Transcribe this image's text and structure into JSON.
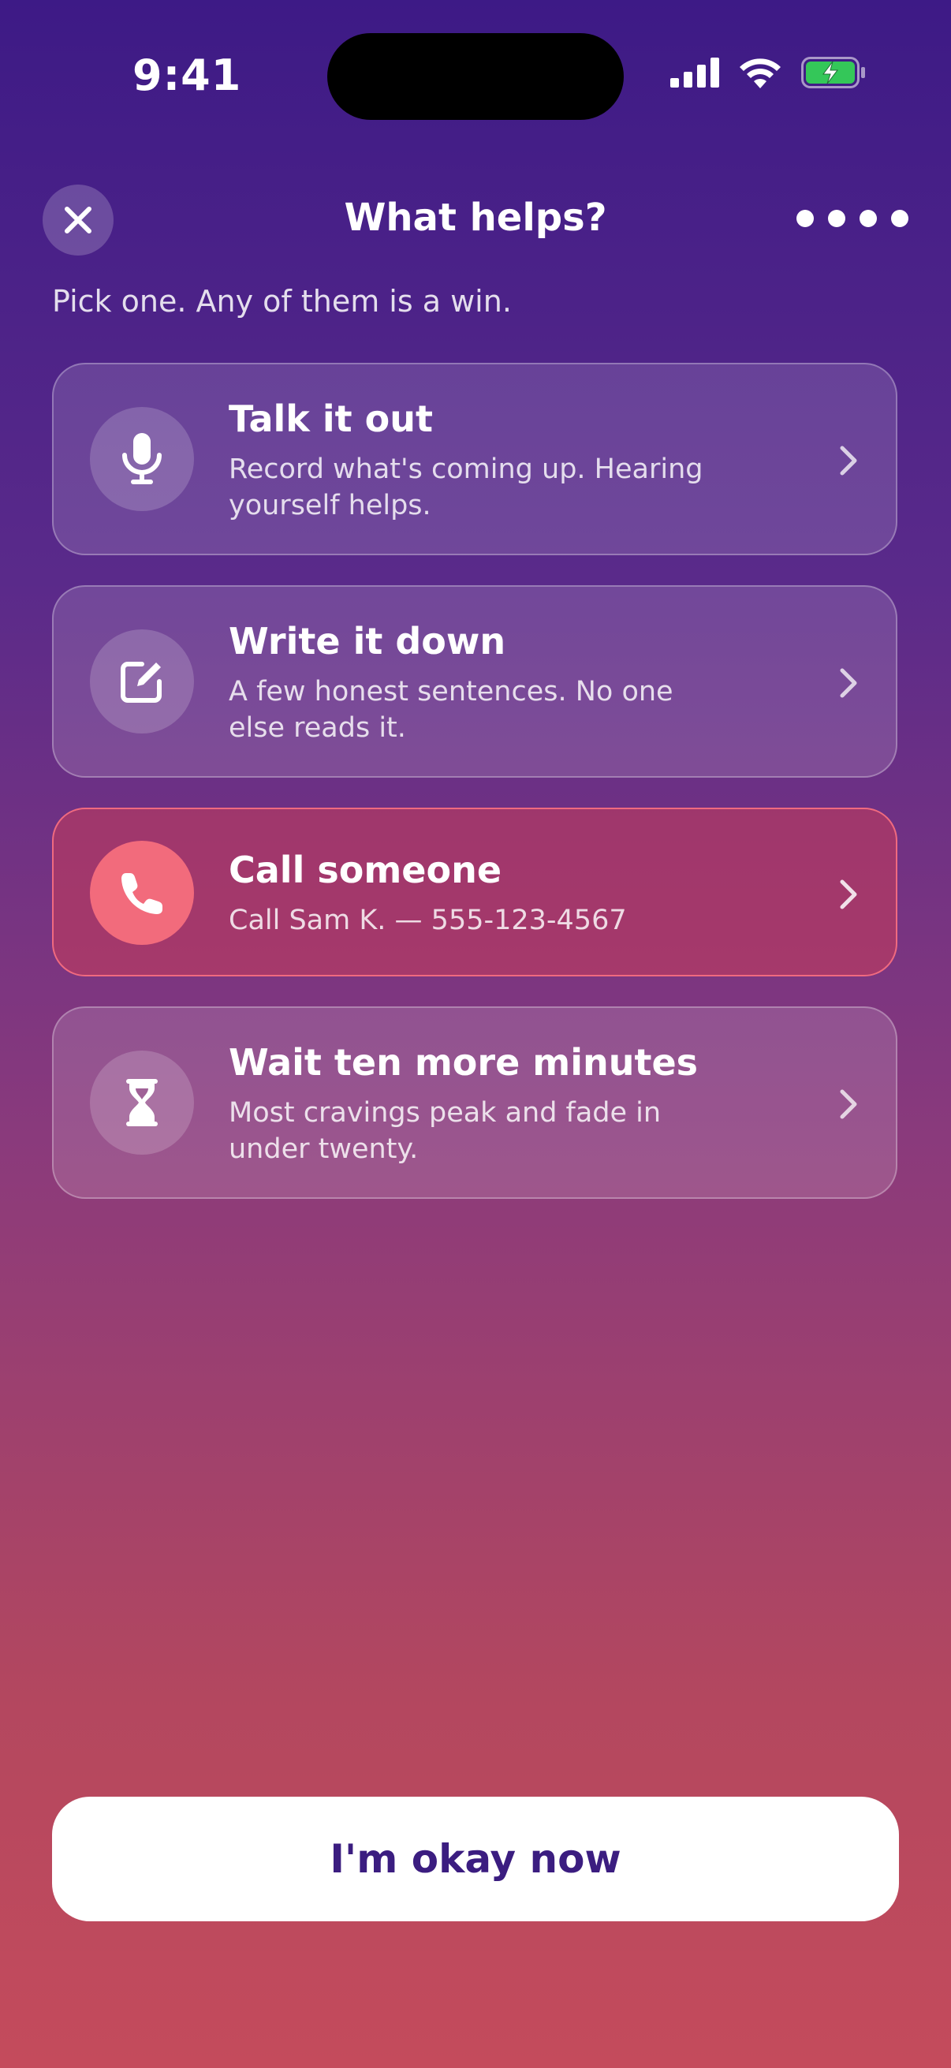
{
  "status_bar": {
    "time": "9:41"
  },
  "header": {
    "title": "What helps?",
    "close_icon": "close-icon",
    "progress_dots": 4
  },
  "subtitle": "Pick one. Any of them is a win.",
  "options": [
    {
      "title": "Talk it out",
      "description": "Record what's coming up. Hearing yourself helps.",
      "icon": "microphone-icon"
    },
    {
      "title": "Write it down",
      "description": "A few honest sentences. No one else reads it.",
      "icon": "edit-icon"
    },
    {
      "title": "Call someone",
      "description": "Call Sam K. — 555-123-4567",
      "icon": "phone-icon",
      "highlighted": true
    },
    {
      "title": "Wait ten more minutes",
      "description": "Most cravings peak and fade in under twenty.",
      "icon": "hourglass-icon"
    }
  ],
  "primary_button": {
    "label": "I'm okay now"
  },
  "colors": {
    "gradient_top": "#3d1a86",
    "gradient_bottom": "#c44b5c",
    "highlight_accent": "#f26b7c",
    "button_text": "#3b1d80",
    "battery_green": "#34c759"
  }
}
